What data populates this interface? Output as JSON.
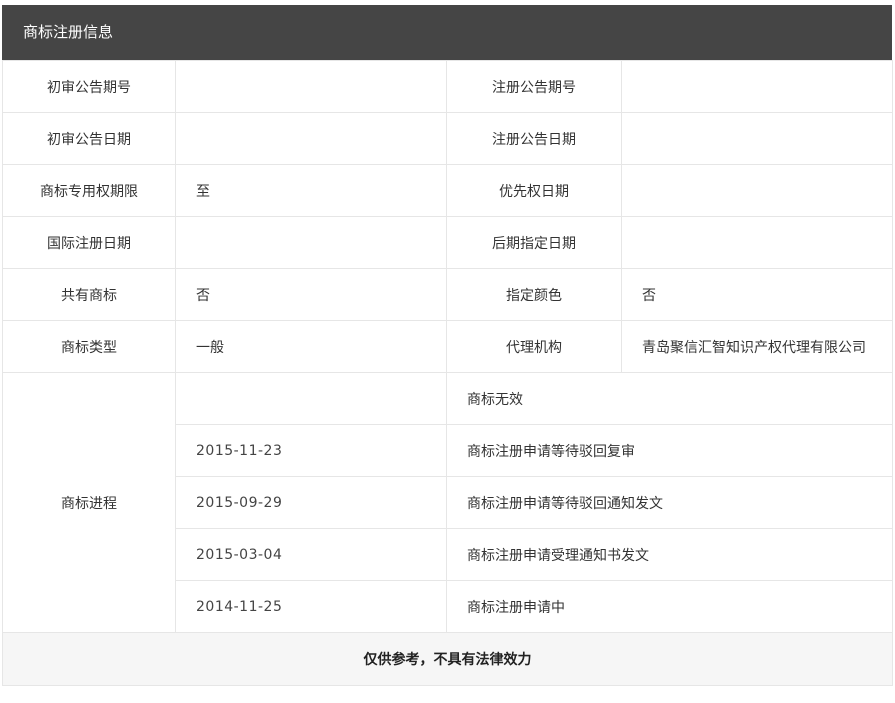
{
  "header": {
    "title": "商标注册信息"
  },
  "rows": {
    "r1": {
      "l1": "初审公告期号",
      "v1": "",
      "l2": "注册公告期号",
      "v2": ""
    },
    "r2": {
      "l1": "初审公告日期",
      "v1": "",
      "l2": "注册公告日期",
      "v2": ""
    },
    "r3": {
      "l1": "商标专用权期限",
      "v1": "至",
      "l2": "优先权日期",
      "v2": ""
    },
    "r4": {
      "l1": "国际注册日期",
      "v1": "",
      "l2": "后期指定日期",
      "v2": ""
    },
    "r5": {
      "l1": "共有商标",
      "v1": "否",
      "l2": "指定颜色",
      "v2": "否"
    },
    "r6": {
      "l1": "商标类型",
      "v1": "一般",
      "l2": "代理机构",
      "v2": "青岛聚信汇智知识产权代理有限公司"
    }
  },
  "progress": {
    "label": "商标进程",
    "items": [
      {
        "date": "",
        "status": "商标无效"
      },
      {
        "date": "2015-11-23",
        "status": "商标注册申请等待驳回复审"
      },
      {
        "date": "2015-09-29",
        "status": "商标注册申请等待驳回通知发文"
      },
      {
        "date": "2015-03-04",
        "status": "商标注册申请受理通知书发文"
      },
      {
        "date": "2014-11-25",
        "status": "商标注册申请中"
      }
    ]
  },
  "footer": {
    "note": "仅供参考，不具有法律效力"
  }
}
